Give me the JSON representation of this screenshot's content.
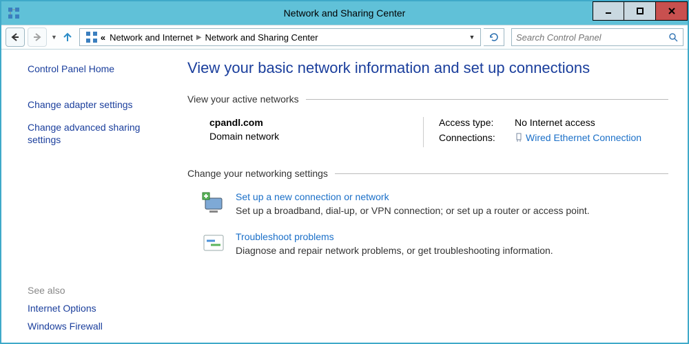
{
  "window": {
    "title": "Network and Sharing Center"
  },
  "breadcrumb": {
    "prefix": "«",
    "part1": "Network and Internet",
    "part2": "Network and Sharing Center"
  },
  "search": {
    "placeholder": "Search Control Panel"
  },
  "sidebar": {
    "items": [
      "Control Panel Home",
      "Change adapter settings",
      "Change advanced sharing settings"
    ],
    "see_also_label": "See also",
    "see_also": [
      "Internet Options",
      "Windows Firewall"
    ]
  },
  "main": {
    "page_title": "View your basic network information and set up connections",
    "active_networks_label": "View your active networks",
    "network": {
      "name": "cpandl.com",
      "type": "Domain network",
      "access_type_label": "Access type:",
      "access_type_value": "No Internet access",
      "connections_label": "Connections:",
      "connection_link": "Wired Ethernet Connection"
    },
    "change_settings_label": "Change your networking settings",
    "options": [
      {
        "title": "Set up a new connection or network",
        "desc": "Set up a broadband, dial-up, or VPN connection; or set up a router or access point."
      },
      {
        "title": "Troubleshoot problems",
        "desc": "Diagnose and repair network problems, or get troubleshooting information."
      }
    ]
  }
}
